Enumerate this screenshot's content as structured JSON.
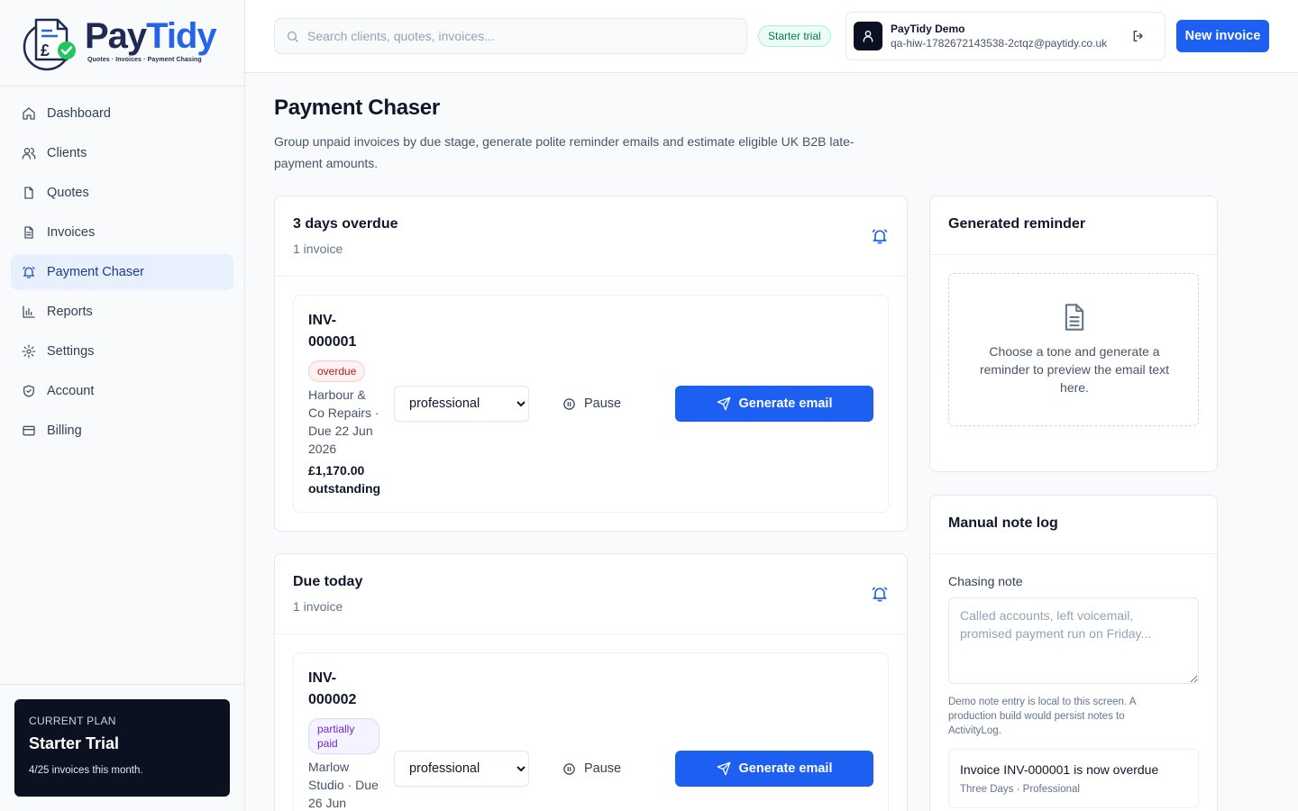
{
  "brand": {
    "name_part1": "Pay",
    "name_part2": "Tidy",
    "tagline": "Quotes · Invoices · Payment Chasing",
    "accent": "#2563eb",
    "navy": "#1e2a52"
  },
  "sidebar": {
    "items": [
      {
        "label": "Dashboard",
        "icon": "home-icon"
      },
      {
        "label": "Clients",
        "icon": "users-icon"
      },
      {
        "label": "Quotes",
        "icon": "file-icon"
      },
      {
        "label": "Invoices",
        "icon": "file-text-icon"
      },
      {
        "label": "Payment Chaser",
        "icon": "bell-ring-icon",
        "active": true
      },
      {
        "label": "Reports",
        "icon": "bar-chart-icon"
      },
      {
        "label": "Settings",
        "icon": "gear-icon"
      },
      {
        "label": "Account",
        "icon": "shield-icon"
      },
      {
        "label": "Billing",
        "icon": "credit-card-icon"
      }
    ],
    "plan": {
      "eyebrow": "CURRENT PLAN",
      "name": "Starter Trial",
      "usage": "4/25 invoices this month."
    }
  },
  "topbar": {
    "search_placeholder": "Search clients, quotes, invoices...",
    "trial_badge": "Starter trial",
    "user_name": "PayTidy Demo",
    "user_email": "qa-hiw-1782672143538-2ctqz@paytidy.co.uk",
    "new_invoice_label": "New invoice"
  },
  "main": {
    "title": "Payment Chaser",
    "description": "Group unpaid invoices by due stage, generate polite reminder emails and estimate eligible UK B2B late-payment amounts.",
    "stages": [
      {
        "title": "3 days overdue",
        "count": "1 invoice",
        "invoice": {
          "number": "INV-000001",
          "status": "overdue",
          "meta": "Harbour & Co Repairs · Due 22 Jun 2026",
          "amount": "£1,170.00 outstanding",
          "tone": "professional",
          "pause_label": "Pause",
          "generate_label": "Generate email"
        }
      },
      {
        "title": "Due today",
        "count": "1 invoice",
        "invoice": {
          "number": "INV-000002",
          "status": "partially paid",
          "meta": "Marlow Studio · Due 26 Jun",
          "tone": "professional",
          "pause_label": "Pause",
          "generate_label": "Generate email"
        }
      }
    ],
    "tone_options": [
      "professional"
    ]
  },
  "reminder": {
    "title": "Generated reminder",
    "empty_text": "Choose a tone and generate a reminder to preview the email text here."
  },
  "notes": {
    "title": "Manual note log",
    "field_label": "Chasing note",
    "placeholder": "Called accounts, left voicemail, promised payment run on Friday...",
    "help": "Demo note entry is local to this screen. A production build would persist notes to ActivityLog.",
    "log": [
      {
        "title": "Invoice INV-000001 is now overdue",
        "meta": "Three Days · Professional"
      }
    ]
  }
}
